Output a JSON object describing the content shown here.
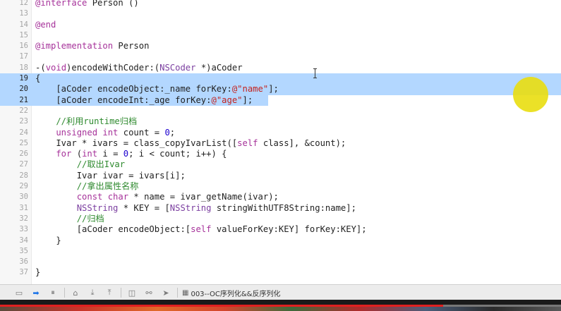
{
  "editor": {
    "lines": [
      {
        "num": "12",
        "selected": false,
        "tokens": [
          [
            "kw",
            "@interface"
          ],
          [
            "pl",
            " Person ()"
          ]
        ]
      },
      {
        "num": "13",
        "selected": false,
        "tokens": []
      },
      {
        "num": "14",
        "selected": false,
        "tokens": [
          [
            "kw",
            "@end"
          ]
        ]
      },
      {
        "num": "15",
        "selected": false,
        "tokens": []
      },
      {
        "num": "16",
        "selected": false,
        "tokens": [
          [
            "kw",
            "@implementation"
          ],
          [
            "pl",
            " Person"
          ]
        ]
      },
      {
        "num": "17",
        "selected": false,
        "tokens": []
      },
      {
        "num": "18",
        "selected": false,
        "tokens": [
          [
            "pl",
            "-("
          ],
          [
            "kw",
            "void"
          ],
          [
            "pl",
            ")encodeWithCoder:("
          ],
          [
            "cls",
            "NSCoder"
          ],
          [
            "pl",
            " *)aCoder"
          ]
        ]
      },
      {
        "num": "19",
        "selected": true,
        "tokens": [
          [
            "pl",
            "{"
          ]
        ]
      },
      {
        "num": "20",
        "selected": true,
        "tokens": [
          [
            "pl",
            "    [aCoder encodeObject:_name forKey:"
          ],
          [
            "str",
            "@\"name\""
          ],
          [
            "pl",
            "];"
          ]
        ]
      },
      {
        "num": "21",
        "selected": true,
        "partial": true,
        "tokens": [
          [
            "pl",
            "    [aCoder encodeInt:_age forKey:"
          ],
          [
            "str",
            "@\"age\""
          ],
          [
            "pl",
            "];"
          ]
        ]
      },
      {
        "num": "22",
        "selected": false,
        "tokens": []
      },
      {
        "num": "23",
        "selected": false,
        "tokens": [
          [
            "cmt",
            "    //利用runtime归档"
          ]
        ]
      },
      {
        "num": "24",
        "selected": false,
        "tokens": [
          [
            "kw",
            "    unsigned int"
          ],
          [
            "pl",
            " count = "
          ],
          [
            "num",
            "0"
          ],
          [
            "pl",
            ";"
          ]
        ]
      },
      {
        "num": "25",
        "selected": false,
        "tokens": [
          [
            "pl",
            "    Ivar * ivars = class_copyIvarList(["
          ],
          [
            "kw",
            "self"
          ],
          [
            "pl",
            " class], &count);"
          ]
        ]
      },
      {
        "num": "26",
        "selected": false,
        "tokens": [
          [
            "kw",
            "    for"
          ],
          [
            "pl",
            " ("
          ],
          [
            "kw",
            "int"
          ],
          [
            "pl",
            " i = "
          ],
          [
            "num",
            "0"
          ],
          [
            "pl",
            "; i < count; i++) {"
          ]
        ]
      },
      {
        "num": "27",
        "selected": false,
        "tokens": [
          [
            "cmt",
            "        //取出Ivar"
          ]
        ]
      },
      {
        "num": "28",
        "selected": false,
        "tokens": [
          [
            "pl",
            "        Ivar ivar = ivars[i];"
          ]
        ]
      },
      {
        "num": "29",
        "selected": false,
        "tokens": [
          [
            "cmt",
            "        //拿出属性名称"
          ]
        ]
      },
      {
        "num": "30",
        "selected": false,
        "tokens": [
          [
            "kw",
            "        const char"
          ],
          [
            "pl",
            " * name = ivar_getName(ivar);"
          ]
        ]
      },
      {
        "num": "31",
        "selected": false,
        "tokens": [
          [
            "cls",
            "        NSString"
          ],
          [
            "pl",
            " * KEY = ["
          ],
          [
            "cls",
            "NSString"
          ],
          [
            "pl",
            " stringWithUTF8String:name];"
          ]
        ]
      },
      {
        "num": "32",
        "selected": false,
        "tokens": [
          [
            "cmt",
            "        //归档"
          ]
        ]
      },
      {
        "num": "33",
        "selected": false,
        "tokens": [
          [
            "pl",
            "        [aCoder encodeObject:["
          ],
          [
            "kw",
            "self"
          ],
          [
            "pl",
            " valueForKey:KEY] forKey:KEY];"
          ]
        ]
      },
      {
        "num": "34",
        "selected": false,
        "tokens": [
          [
            "pl",
            "    }"
          ]
        ]
      },
      {
        "num": "35",
        "selected": false,
        "tokens": []
      },
      {
        "num": "36",
        "selected": false,
        "tokens": []
      },
      {
        "num": "37",
        "selected": false,
        "tokens": [
          [
            "pl",
            "}"
          ]
        ]
      }
    ]
  },
  "debugbar": {
    "buttons": [
      {
        "name": "console-toggle-icon",
        "glyph": "▭",
        "active": false
      },
      {
        "name": "breakpoints-toggle-icon",
        "glyph": "➡",
        "active": true
      },
      {
        "name": "pause-icon",
        "glyph": "⏸",
        "active": false
      },
      {
        "name": "step-over-icon",
        "glyph": "⌂",
        "active": false
      },
      {
        "name": "step-into-icon",
        "glyph": "⤓",
        "active": false
      },
      {
        "name": "step-out-icon",
        "glyph": "⤒",
        "active": false
      },
      {
        "name": "view-debugger-icon",
        "glyph": "◫",
        "active": false
      },
      {
        "name": "memory-graph-icon",
        "glyph": "⚯",
        "active": false
      },
      {
        "name": "location-icon",
        "glyph": "➤",
        "active": false
      }
    ],
    "breadcrumb_label": "003--OC序列化&&反序列化",
    "breadcrumb_icon": "▦"
  },
  "colors": {
    "selection": "#b3d7ff",
    "keyword": "#a6329a",
    "string": "#c4221d",
    "comment": "#2f8a2f",
    "number": "#1c00cf",
    "active_blue": "#1a73e8"
  }
}
